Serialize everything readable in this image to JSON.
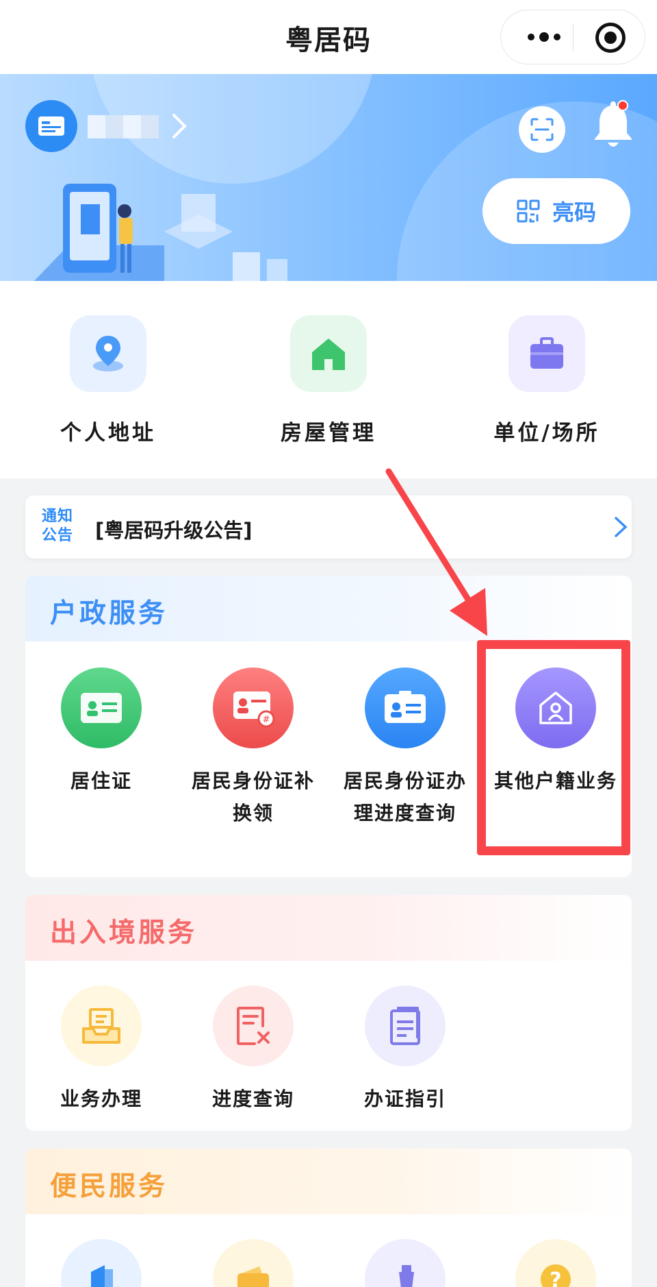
{
  "app": {
    "title": "粤居码"
  },
  "capsule": {
    "more_icon": "more-dots-icon",
    "close_icon": "target-icon"
  },
  "banner": {
    "user_name": "",
    "scan_icon": "scan-icon",
    "bell_icon": "bell-icon",
    "show_code_label": "亮码"
  },
  "quick_actions": [
    {
      "label": "个人地址",
      "icon": "location-pin-icon",
      "bg": "#e8f1ff",
      "color": "#4a9af7"
    },
    {
      "label": "房屋管理",
      "icon": "house-icon",
      "bg": "#e6f8ec",
      "color": "#3ec46d"
    },
    {
      "label": "单位/场所",
      "icon": "briefcase-icon",
      "bg": "#efedff",
      "color": "#7d77f0"
    }
  ],
  "notice": {
    "tag_line1": "通知",
    "tag_line2": "公告",
    "text": "[粤居码升级公告]"
  },
  "sections": {
    "household": {
      "title": "户政服务",
      "title_color": "#3d8ff5",
      "items": [
        {
          "label": "居住证",
          "icon": "residence-card-icon",
          "color": "#33c270"
        },
        {
          "label": "居民身份证补换领",
          "icon": "id-card-replace-icon",
          "color": "#f15a5a"
        },
        {
          "label": "居民身份证办理进度查询",
          "icon": "id-card-progress-icon",
          "color": "#2f8cf5"
        },
        {
          "label": "其他户籍业务",
          "icon": "house-person-icon",
          "color": "#8b7cf0"
        }
      ]
    },
    "border": {
      "title": "出入境服务",
      "title_color": "#f56a6a",
      "items": [
        {
          "label": "业务办理",
          "icon": "inbox-tray-icon",
          "color": "#f6b93b"
        },
        {
          "label": "进度查询",
          "icon": "document-x-icon",
          "color": "#f06262"
        },
        {
          "label": "办证指引",
          "icon": "document-list-icon",
          "color": "#7e7ae8"
        }
      ]
    },
    "convenience": {
      "title": "便民服务",
      "title_color": "#f5a03a",
      "items": [
        {
          "label": "",
          "icon": "book-icon",
          "color": "#2f8cf5"
        },
        {
          "label": "",
          "icon": "wallet-icon",
          "color": "#f6b93b"
        },
        {
          "label": "",
          "icon": "bottle-icon",
          "color": "#7e7ae8"
        },
        {
          "label": "",
          "icon": "question-icon",
          "color": "#f6b93b"
        }
      ]
    }
  }
}
